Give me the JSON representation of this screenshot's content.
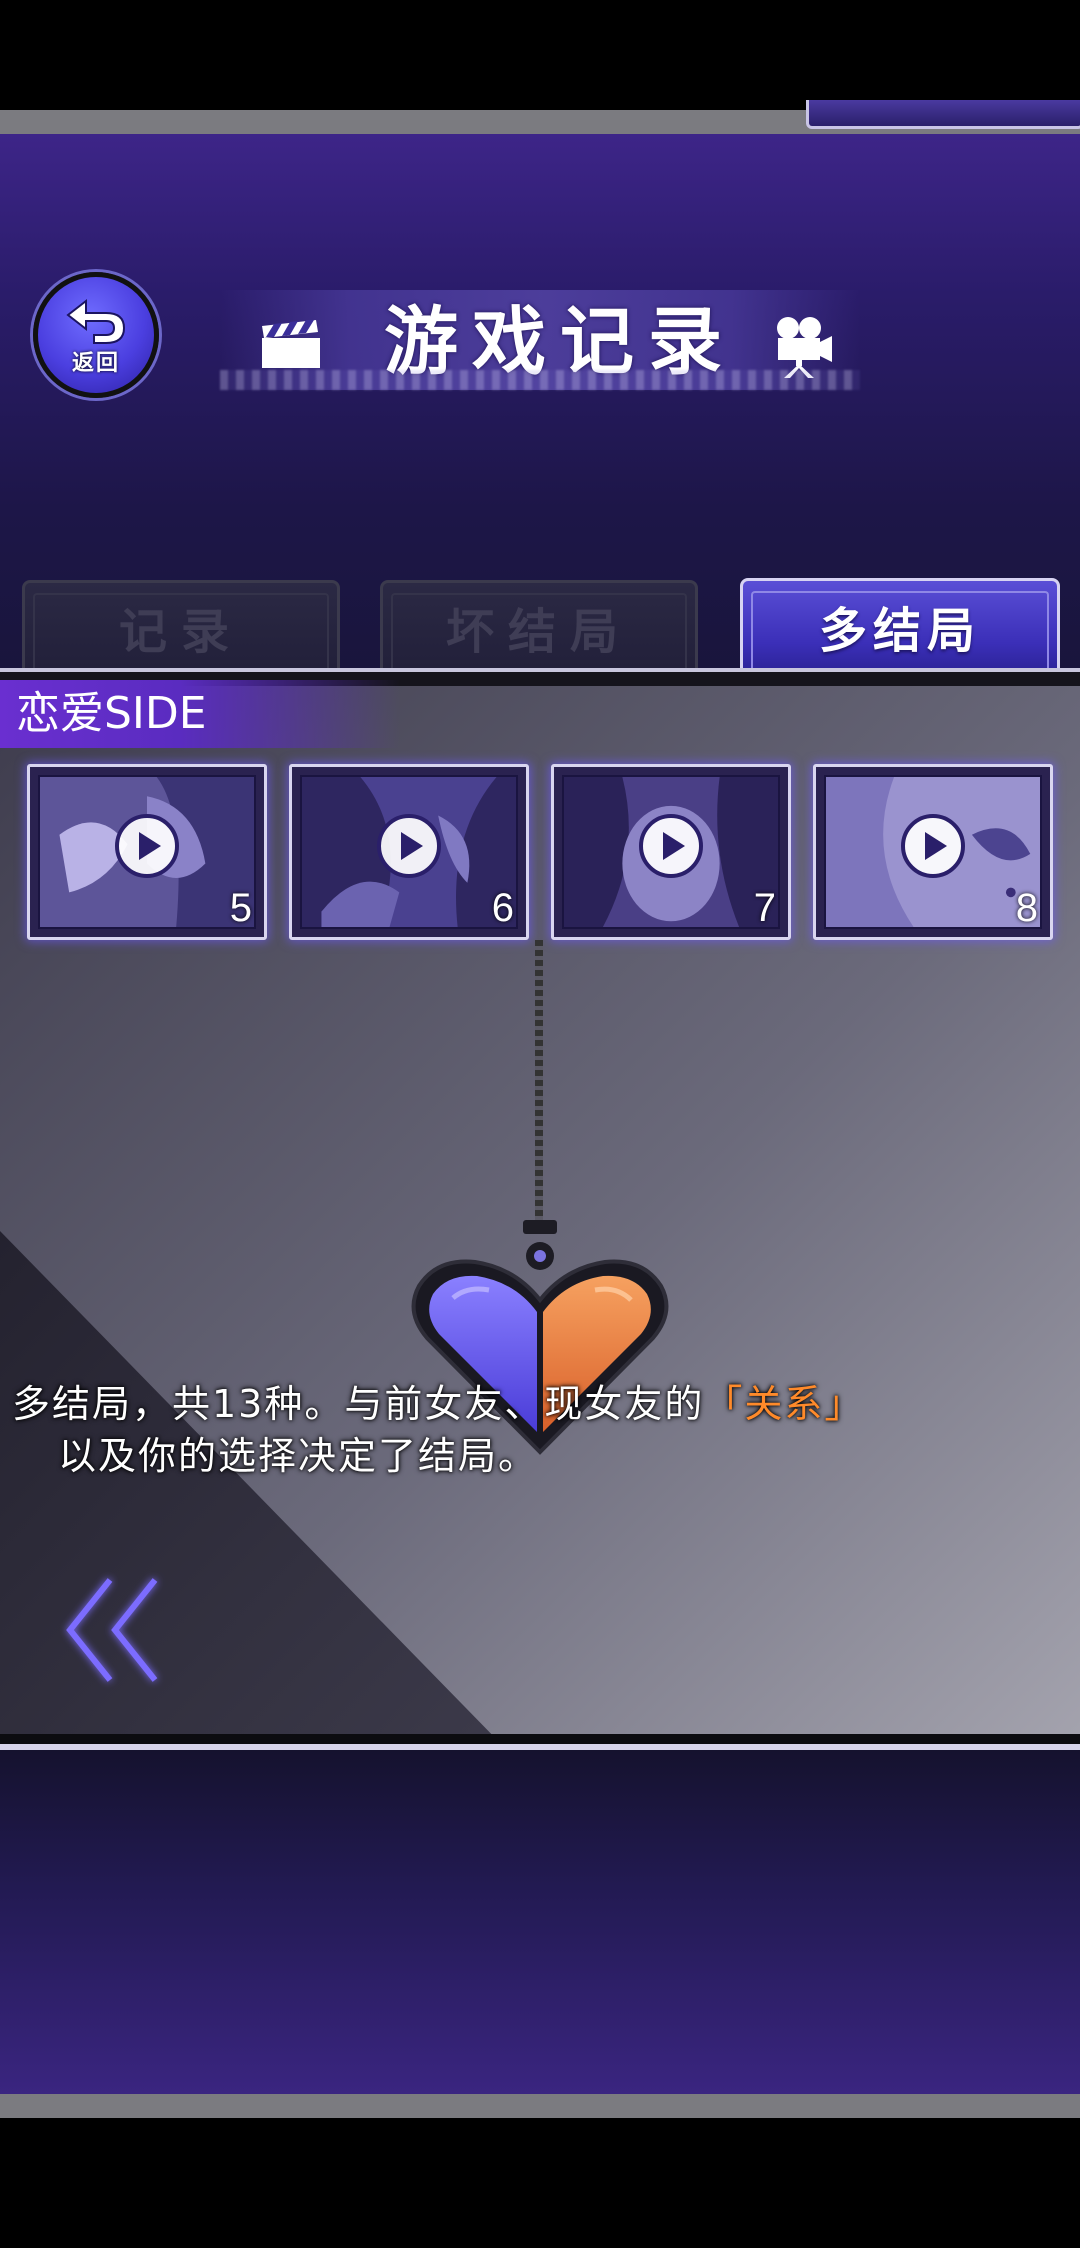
{
  "header": {
    "back_label": "返回",
    "title": "游戏记录"
  },
  "tabs": [
    {
      "label": "记录",
      "active": false
    },
    {
      "label": "坏结局",
      "active": false
    },
    {
      "label": "多结局",
      "active": true
    }
  ],
  "section": {
    "label": "恋爱SIDE"
  },
  "thumbnails": [
    {
      "number": "5"
    },
    {
      "number": "6"
    },
    {
      "number": "7"
    },
    {
      "number": "8"
    }
  ],
  "description": {
    "line1_prefix": "多结局，共13种。与前女友、现女友的",
    "line1_highlight": "「关系」",
    "line2": "以及你的选择决定了结局。"
  },
  "colors": {
    "accent_purple": "#5a4fd6",
    "highlight_orange": "#ff8a2a",
    "heart_left": "#6a5cf0",
    "heart_right": "#e8773a"
  },
  "icons": {
    "back": "back-arrow-icon",
    "title_left": "clapperboard-icon",
    "title_right": "movie-camera-icon",
    "thumbnail_overlay": "play-icon",
    "nav": "double-chevron-left-icon"
  }
}
